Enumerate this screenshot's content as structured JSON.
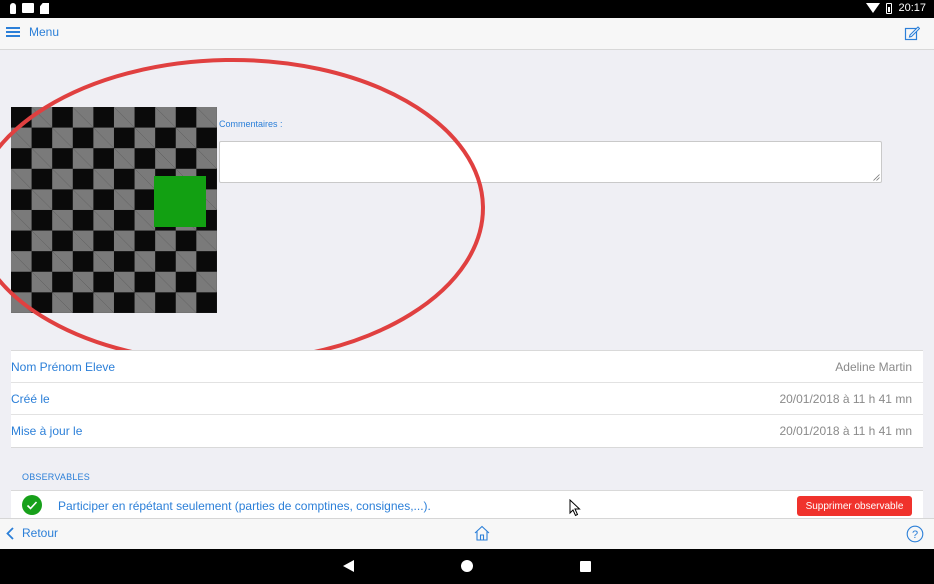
{
  "status_bar": {
    "time": "20:17"
  },
  "header": {
    "menu_label": "Menu"
  },
  "comment": {
    "label": "Commentaires :",
    "value": ""
  },
  "info_rows": [
    {
      "key": "Nom Prénom Eleve",
      "value": "Adeline Martin"
    },
    {
      "key": "Créé le",
      "value": "20/01/2018 à 11 h 41 mn"
    },
    {
      "key": "Mise à jour le",
      "value": "20/01/2018 à 11 h 41 mn"
    }
  ],
  "observables": {
    "section_title": "OBSERVABLES",
    "items": [
      {
        "text": "Participer en répétant seulement (parties de comptines, consignes,...).",
        "delete_label": "Supprimer observable"
      }
    ]
  },
  "toolbar": {
    "back_label": "Retour"
  },
  "colors": {
    "accent": "#2b7fd8",
    "annotation": "#e04040",
    "success": "#17a01a",
    "danger": "#f0322c"
  }
}
